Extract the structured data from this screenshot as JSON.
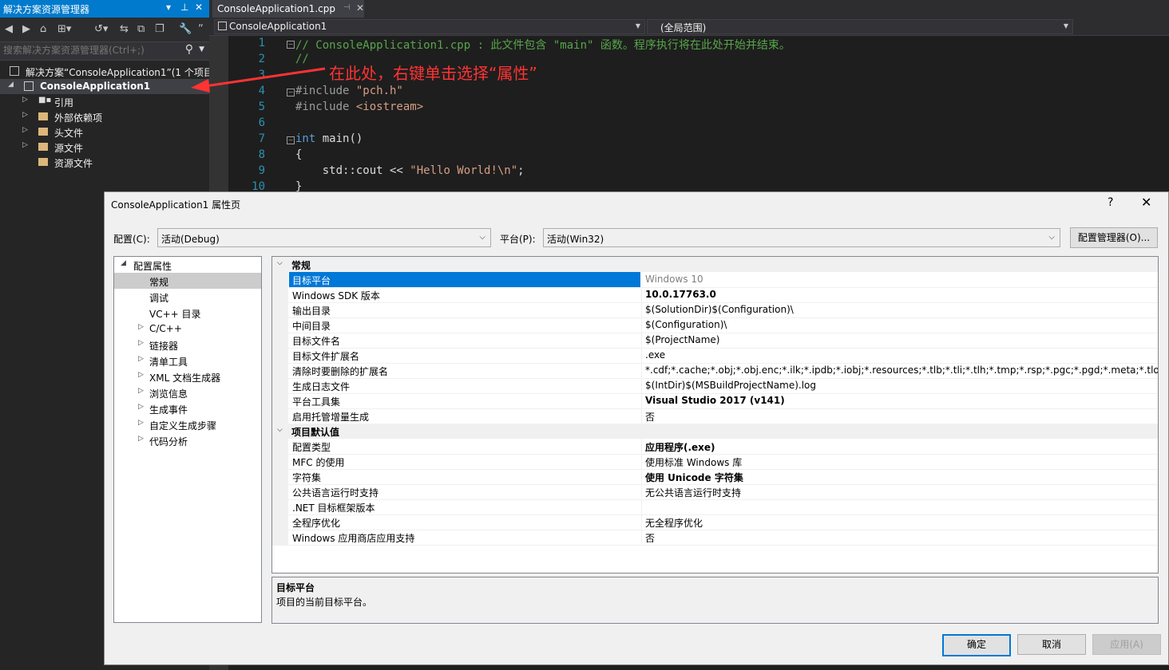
{
  "solution_explorer": {
    "title": "解决方案资源管理器",
    "search_placeholder": "搜索解决方案资源管理器(Ctrl+;)",
    "tree": [
      {
        "label": "解决方案“ConsoleApplication1”(1 个项目"
      },
      {
        "label": "ConsoleApplication1"
      },
      {
        "label": "引用"
      },
      {
        "label": "外部依赖项"
      },
      {
        "label": "头文件"
      },
      {
        "label": "源文件"
      },
      {
        "label": "资源文件"
      }
    ]
  },
  "editor": {
    "tab_label": "ConsoleApplication1.cpp",
    "nav_project": "ConsoleApplication1",
    "nav_scope": "(全局范围)",
    "line_numbers": [
      "1",
      "2",
      "3",
      "4",
      "5",
      "6",
      "7",
      "8",
      "9",
      "10"
    ],
    "code": {
      "l1": "// ConsoleApplication1.cpp : 此文件包含 \"main\" 函数。程序执行将在此处开始并结束。",
      "l2": "//",
      "l4_pp": "#include ",
      "l4_str": "\"pch.h\"",
      "l5_pp": "#include ",
      "l5_str": "<iostream>",
      "l7_kw": "int",
      "l7_rest": " main()",
      "l8": "{",
      "l9_a": "    std::cout << ",
      "l9_str": "\"Hello World!\\n\"",
      "l9_b": ";",
      "l10": "}"
    },
    "annotation": "在此处，右键单击选择“属性”"
  },
  "dialog": {
    "title": "ConsoleApplication1 属性页",
    "help": "?",
    "close": "✕",
    "config_label": "配置(C):",
    "config_value": "活动(Debug)",
    "platform_label": "平台(P):",
    "platform_value": "活动(Win32)",
    "config_manager_button": "配置管理器(O)...",
    "nav_tree": [
      {
        "label": "配置属性"
      },
      {
        "label": "常规"
      },
      {
        "label": "调试"
      },
      {
        "label": "VC++ 目录"
      },
      {
        "label": "C/C++"
      },
      {
        "label": "链接器"
      },
      {
        "label": "清单工具"
      },
      {
        "label": "XML 文档生成器"
      },
      {
        "label": "浏览信息"
      },
      {
        "label": "生成事件"
      },
      {
        "label": "自定义生成步骤"
      },
      {
        "label": "代码分析"
      }
    ],
    "categories": [
      {
        "name": "常规",
        "rows": [
          {
            "name": "目标平台",
            "value": "Windows 10"
          },
          {
            "name": "Windows SDK 版本",
            "value": "10.0.17763.0"
          },
          {
            "name": "输出目录",
            "value": "$(SolutionDir)$(Configuration)\\"
          },
          {
            "name": "中间目录",
            "value": "$(Configuration)\\"
          },
          {
            "name": "目标文件名",
            "value": "$(ProjectName)"
          },
          {
            "name": "目标文件扩展名",
            "value": ".exe"
          },
          {
            "name": "清除时要删除的扩展名",
            "value": "*.cdf;*.cache;*.obj;*.obj.enc;*.ilk;*.ipdb;*.iobj;*.resources;*.tlb;*.tli;*.tlh;*.tmp;*.rsp;*.pgc;*.pgd;*.meta;*.tlog;*.manife"
          },
          {
            "name": "生成日志文件",
            "value": "$(IntDir)$(MSBuildProjectName).log"
          },
          {
            "name": "平台工具集",
            "value": "Visual Studio 2017 (v141)"
          },
          {
            "name": "启用托管增量生成",
            "value": "否"
          }
        ]
      },
      {
        "name": "项目默认值",
        "rows": [
          {
            "name": "配置类型",
            "value": "应用程序(.exe)"
          },
          {
            "name": "MFC 的使用",
            "value": "使用标准 Windows 库"
          },
          {
            "name": "字符集",
            "value": "使用 Unicode 字符集"
          },
          {
            "name": "公共语言运行时支持",
            "value": "无公共语言运行时支持"
          },
          {
            "name": ".NET 目标框架版本",
            "value": ""
          },
          {
            "name": "全程序优化",
            "value": "无全程序优化"
          },
          {
            "name": "Windows 应用商店应用支持",
            "value": "否"
          }
        ]
      }
    ],
    "description": {
      "title": "目标平台",
      "text": "项目的当前目标平台。"
    },
    "buttons": {
      "ok": "确定",
      "cancel": "取消",
      "apply": "应用(A)"
    }
  },
  "colors": {
    "accent": "#007acc",
    "selection": "#0078d7",
    "annotation": "#ff3333"
  }
}
